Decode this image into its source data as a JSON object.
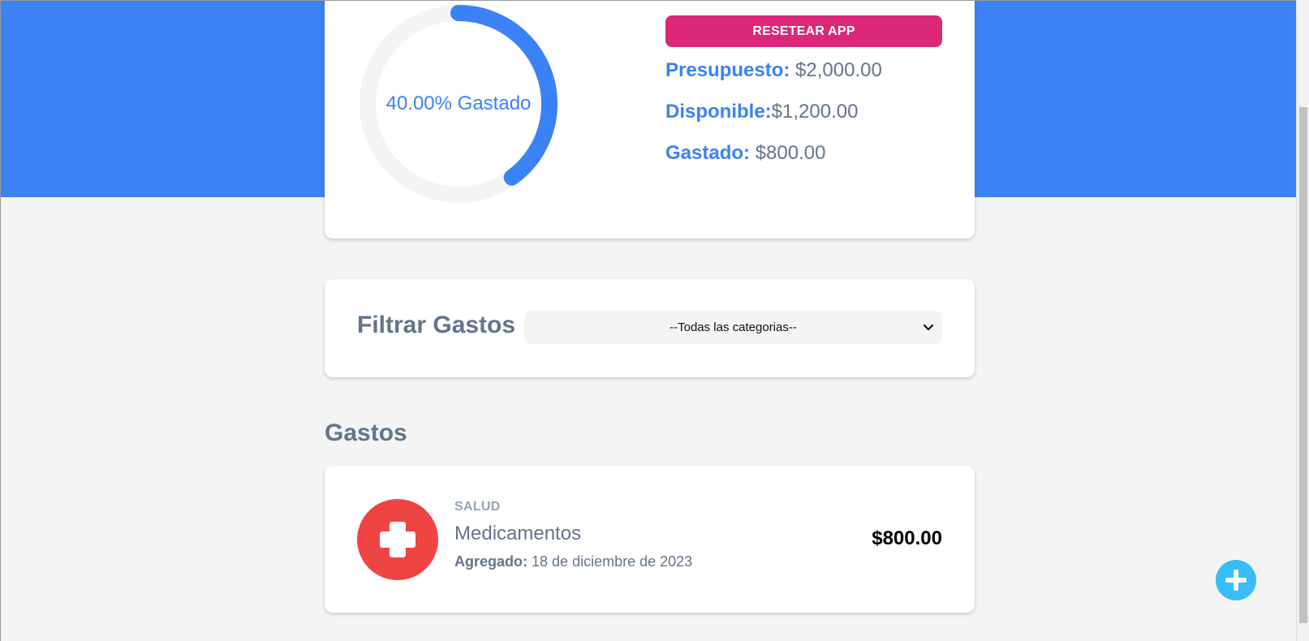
{
  "progress": {
    "percent": 40,
    "label": "40.00% Gastado",
    "track_color": "#f3f4f6",
    "fill_color": "#3b82f6"
  },
  "budget": {
    "reset_label": "RESETEAR APP",
    "presupuesto_label": "Presupuesto:",
    "presupuesto_value": "$2,000.00",
    "disponible_label": "Disponible:",
    "disponible_value": "$1,200.00",
    "gastado_label": "Gastado:",
    "gastado_value": "$800.00"
  },
  "filter": {
    "title": "Filtrar Gastos",
    "selected": "--Todas las categorias--"
  },
  "gastos": {
    "heading": "Gastos",
    "items": [
      {
        "category": "SALUD",
        "icon": "medical-cross-icon",
        "name": "Medicamentos",
        "date_label": "Agregado:",
        "date": "18 de diciembre de 2023",
        "amount": "$800.00"
      }
    ]
  },
  "colors": {
    "header_blue": "#3b82f6",
    "reset_pink": "#db2777",
    "salud_red": "#ef4444",
    "fab_blue": "#38bdf8"
  }
}
